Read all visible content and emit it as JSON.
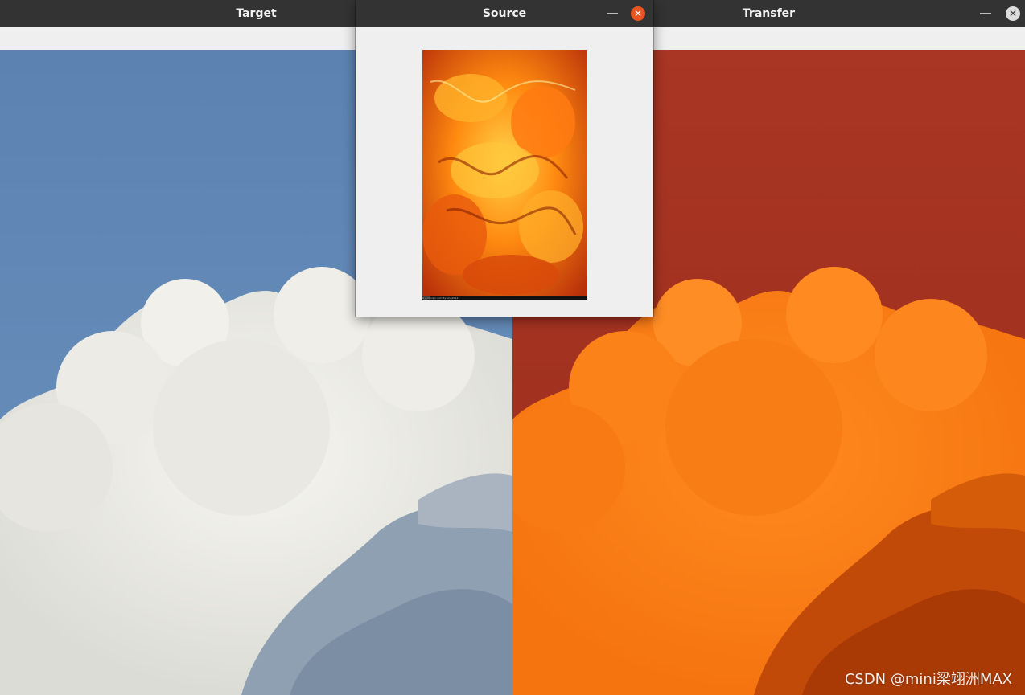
{
  "windows": {
    "target": {
      "title": "Target"
    },
    "source": {
      "title": "Source",
      "image_caption": "昵图网 nipic.com  By:fang2014"
    },
    "transfer": {
      "title": "Transfer"
    }
  },
  "icons": {
    "minimize": "minimize-icon",
    "close": "close-icon"
  },
  "watermark": "CSDN @mini梁翊洲MAX",
  "colors": {
    "titlebar": "#333333",
    "close_active": "#e95420",
    "window_bg": "#efefef",
    "sky_blue": "#5f86b3",
    "sky_red": "#a0311f",
    "cloud_orange": "#ff7f12"
  }
}
